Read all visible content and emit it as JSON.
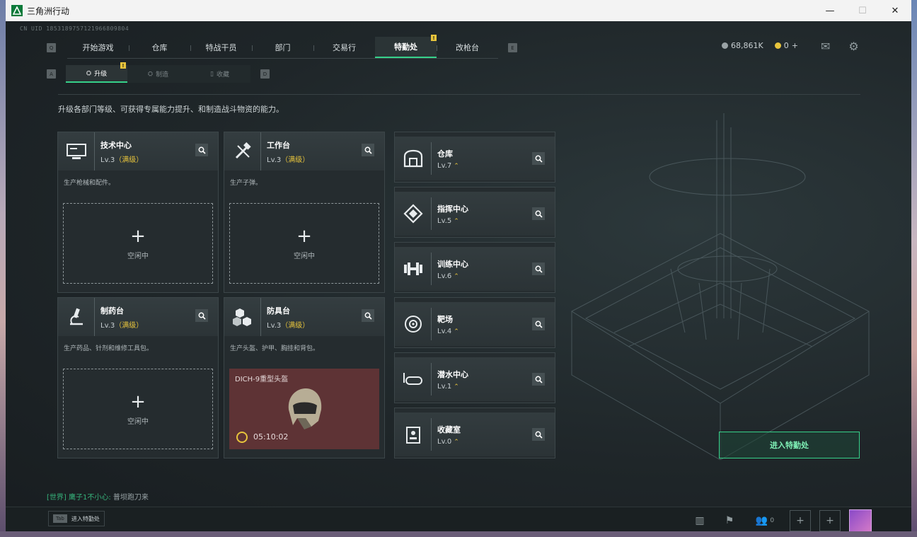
{
  "window": {
    "title": "三角洲行动",
    "minimize": "—",
    "maximize": "☐",
    "close": "✕"
  },
  "uid": "CN UID 1853189757121966809804",
  "topnav": {
    "left_key": "Q",
    "right_key": "E",
    "tabs": [
      {
        "label": "开始游戏"
      },
      {
        "label": "仓库"
      },
      {
        "label": "特战干员"
      },
      {
        "label": "部门"
      },
      {
        "label": "交易行"
      },
      {
        "label": "特勤处",
        "active": true,
        "badge": "!"
      },
      {
        "label": "改枪台"
      }
    ]
  },
  "currency": {
    "silver": "68,861K",
    "gold": "0",
    "plus": "+"
  },
  "subnav": {
    "left_key": "A",
    "right_key": "D",
    "tabs": [
      {
        "label": "升级",
        "active": true,
        "badge": "!"
      },
      {
        "label": "制造"
      },
      {
        "label": "收藏"
      }
    ]
  },
  "description": "升级各部门等级、可获得专属能力提升、和制造战斗物资的能力。",
  "workshops": [
    {
      "name": "技术中心",
      "level": "Lv.3",
      "max": "（满级）",
      "desc": "生产枪械和配件。",
      "slot": {
        "plus": "+",
        "status": "空闲中"
      }
    },
    {
      "name": "工作台",
      "level": "Lv.3",
      "max": "（满级）",
      "desc": "生产子弹。",
      "slot": {
        "plus": "+",
        "status": "空闲中"
      }
    },
    {
      "name": "制药台",
      "level": "Lv.3",
      "max": "（满级）",
      "desc": "生产药品、针剂和维修工具包。",
      "slot": {
        "plus": "+",
        "status": "空闲中"
      }
    },
    {
      "name": "防具台",
      "level": "Lv.3",
      "max": "（满级）",
      "desc": "生产头盔、护甲、胸挂和背包。",
      "crafting": {
        "item": "DICH-9重型头盔",
        "timer": "05:10:02"
      }
    }
  ],
  "facilities": [
    {
      "name": "仓库",
      "level": "Lv.7"
    },
    {
      "name": "指挥中心",
      "level": "Lv.5"
    },
    {
      "name": "训练中心",
      "level": "Lv.6"
    },
    {
      "name": "靶场",
      "level": "Lv.4"
    },
    {
      "name": "潜水中心",
      "level": "Lv.1"
    },
    {
      "name": "收藏室",
      "level": "Lv.0"
    }
  ],
  "enter_button": "进入特勤处",
  "chat": {
    "channel": "[世界]",
    "user": "鹰子1不小心:",
    "message": "普坝跑刀来"
  },
  "bottom": {
    "tab_key": "Tab",
    "tab_label": "进入特勤处",
    "friends_count": "0"
  },
  "colors": {
    "accent": "#36d18a",
    "gold": "#e7c43c",
    "crafting_bg": "#5e3335"
  }
}
